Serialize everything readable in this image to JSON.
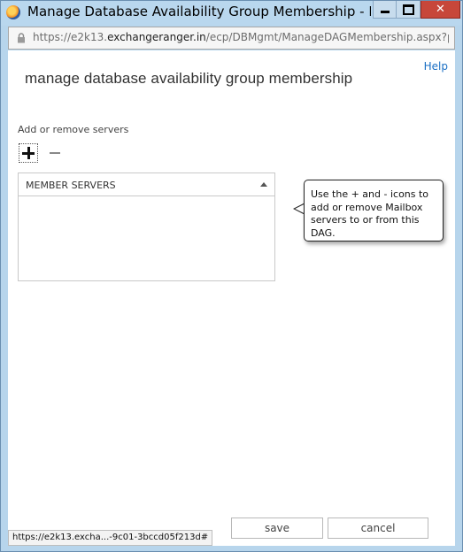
{
  "window": {
    "title": "Manage Database Availability Group Membership - Mozill...",
    "close_glyph": "✕"
  },
  "address_bar": {
    "url_prefix": "https://e2k13.",
    "url_domain": "exchangeranger.in",
    "url_suffix": "/ecp/DBMgmt/ManageDAGMembership.aspx?pwmc"
  },
  "page": {
    "help_label": "Help",
    "title": "manage database availability group membership",
    "section_label": "Add or remove servers"
  },
  "grid": {
    "column_header": "MEMBER SERVERS",
    "rows": []
  },
  "tooltip": {
    "text": "Use the + and - icons to add or remove Mailbox servers to or from this DAG."
  },
  "footer": {
    "save_label": "save",
    "cancel_label": "cancel"
  },
  "status": {
    "link_preview": "https://e2k13.excha...-9c01-3bccd05f213d#"
  },
  "icons": {
    "app": "firefox-icon",
    "lock": "lock-icon",
    "add": "plus-icon",
    "remove": "minus-icon",
    "sort": "sort-ascending-icon"
  }
}
